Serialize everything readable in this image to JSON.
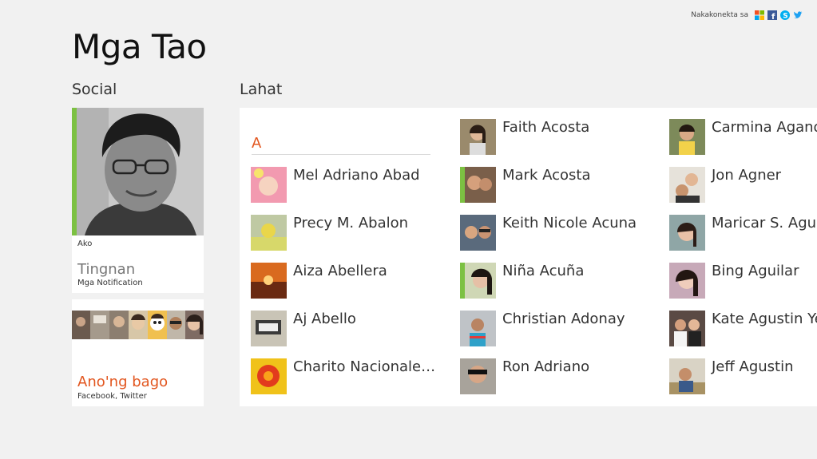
{
  "header": {
    "title": "Mga Tao",
    "connected_label": "Nakakonekta sa",
    "services": [
      "windows-icon",
      "facebook-icon",
      "skype-icon",
      "twitter-icon"
    ]
  },
  "social": {
    "heading": "Social",
    "me": {
      "label": "Ako",
      "view": "Tingnan",
      "notifications": "Mga Notification"
    },
    "whats_new": {
      "title": "Ano'ng bago",
      "sources": "Facebook, Twitter"
    }
  },
  "all": {
    "heading": "Lahat",
    "letter": "A",
    "columns": [
      [
        "Mel Adriano Abad",
        "Precy M. Abalon",
        "Aiza Abellera",
        "Aj Abello",
        "Charito Nacionale…"
      ],
      [
        "Faith Acosta",
        "Mark Acosta",
        "Keith Nicole Acuna",
        "Niña Acuña",
        "Christian Adonay",
        "Ron Adriano"
      ],
      [
        "Carmina Agano",
        "Jon Agner",
        "Maricar S. Agua",
        "Bing Aguilar",
        "Kate Agustin Yeh",
        "Jeff Agustin"
      ]
    ]
  },
  "colors": {
    "accent": "#e2561f",
    "me_bar": "#7cc142",
    "background": "#f1f1f1"
  }
}
